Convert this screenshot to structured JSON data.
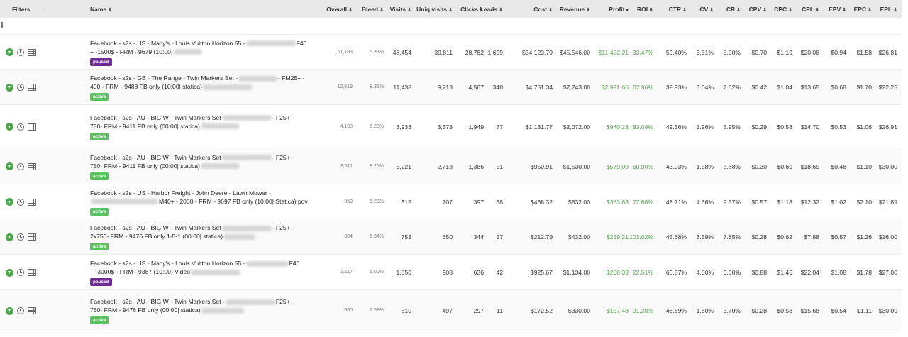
{
  "header": {
    "filters": "Filters",
    "columns": [
      {
        "key": "name",
        "label": "Name",
        "sort": "⬍"
      },
      {
        "key": "overall",
        "label": "Overall",
        "sort": "⬍"
      },
      {
        "key": "bleed",
        "label": "Bleed",
        "sort": "⬍"
      },
      {
        "key": "visits",
        "label": "Visits",
        "sort": "⬍"
      },
      {
        "key": "uniq",
        "label": "Uniq visits",
        "sort": "⬍"
      },
      {
        "key": "clicks",
        "label": "Clicks",
        "sort": "⬍"
      },
      {
        "key": "leads",
        "label": "Leads",
        "sort": "⬍"
      },
      {
        "key": "cost",
        "label": "Cost",
        "sort": "⬍"
      },
      {
        "key": "revenue",
        "label": "Revenue",
        "sort": "⬍"
      },
      {
        "key": "profit",
        "label": "Profit",
        "sort": "▾"
      },
      {
        "key": "roi",
        "label": "ROI",
        "sort": "⬍"
      },
      {
        "key": "ctr",
        "label": "CTR",
        "sort": "⬍"
      },
      {
        "key": "cv",
        "label": "CV",
        "sort": "⬍"
      },
      {
        "key": "cr",
        "label": "CR",
        "sort": "⬍"
      },
      {
        "key": "cpv",
        "label": "CPV",
        "sort": "⬍"
      },
      {
        "key": "cpc",
        "label": "CPC",
        "sort": "⬍"
      },
      {
        "key": "cpl",
        "label": "CPL",
        "sort": "⬍"
      },
      {
        "key": "epv",
        "label": "EPV",
        "sort": "⬍"
      },
      {
        "key": "epc",
        "label": "EPC",
        "sort": "⬍"
      },
      {
        "key": "epl",
        "label": "EPL",
        "sort": "⬍"
      }
    ]
  },
  "colors": {
    "paused": "#6f2c91",
    "active": "#5cbf60",
    "profit": "#55a54f",
    "play_icon": "#4ca64c"
  },
  "icons": [
    "play-circle-icon",
    "clock-icon",
    "table-icon"
  ],
  "rows": [
    {
      "name_line1": "Facebook - s2s - US - Macy's - Louis Vuitton Horizon 55 -",
      "name_line1_tail": "F40",
      "name_line2": "+ -1500$ - FRM - 9679 (10:00)",
      "name_line2_tail": "",
      "status": "paused",
      "overall": "51,183",
      "bleed": "5.33%",
      "visits": "48,454",
      "uniq": "39,811",
      "clicks": "28,782",
      "leads": "1,699",
      "cost": "$34,123.79",
      "revenue": "$45,546.00",
      "profit": "$11,422.21",
      "roi": "33.47%",
      "ctr": "59.40%",
      "cv": "3.51%",
      "cr": "5.90%",
      "cpv": "$0.70",
      "cpc": "$1.19",
      "cpl": "$20.08",
      "epv": "$0.94",
      "epc": "$1.58",
      "epl": "$26.81"
    },
    {
      "name_line1": "Facebook - s2s - GB - The Range - Twin Markers Set -",
      "name_line1_tail": "- FM25+ -",
      "name_line2": "400 - FRM - 9488 FB only (10:00| statica)",
      "name_line2_tail": "",
      "status": "active",
      "overall": "12,619",
      "bleed": "9.36%",
      "visits": "11,438",
      "uniq": "9,213",
      "clicks": "4,567",
      "leads": "348",
      "cost": "$4,751.34",
      "revenue": "$7,743.00",
      "profit": "$2,991.66",
      "roi": "62.96%",
      "ctr": "39.93%",
      "cv": "3.04%",
      "cr": "7.62%",
      "cpv": "$0.42",
      "cpc": "$1.04",
      "cpl": "$13.65",
      "epv": "$0.68",
      "epc": "$1.70",
      "epl": "$22.25"
    },
    {
      "name_line1": "Facebook - s2s - AU - BIG W - Twin Markers Set",
      "name_line1_tail": "- F25+ -",
      "name_line2": "750- FRM - 9411 FB only (00:00| statica)",
      "name_line2_tail": "",
      "status": "active",
      "overall": "4,193",
      "bleed": "6.20%",
      "visits": "3,933",
      "uniq": "3,373",
      "clicks": "1,949",
      "leads": "77",
      "cost": "$1,131.77",
      "revenue": "$2,072.00",
      "profit": "$940.23",
      "roi": "83.08%",
      "ctr": "49.56%",
      "cv": "1.96%",
      "cr": "3.95%",
      "cpv": "$0.29",
      "cpc": "$0.58",
      "cpl": "$14.70",
      "epv": "$0.53",
      "epc": "$1.06",
      "epl": "$26.91"
    },
    {
      "name_line1": "Facebook - s2s - AU - BIG W - Twin Markers Set",
      "name_line1_tail": "- F25+ -",
      "name_line2": "750- FRM - 9411 FB only (00:00| statica)",
      "name_line2_tail": "",
      "status": "active",
      "overall": "3,511",
      "bleed": "8.26%",
      "visits": "3,221",
      "uniq": "2,713",
      "clicks": "1,386",
      "leads": "51",
      "cost": "$950.91",
      "revenue": "$1,530.00",
      "profit": "$579.09",
      "roi": "60.90%",
      "ctr": "43.03%",
      "cv": "1.58%",
      "cr": "3.68%",
      "cpv": "$0.30",
      "cpc": "$0.69",
      "cpl": "$18.65",
      "epv": "$0.48",
      "epc": "$1.10",
      "epl": "$30.00"
    },
    {
      "name_line1": "Facebook - s2s - US - Harbor Freight - John Deere - Lawn Mower -",
      "name_line1_tail": "",
      "name_line2": "M40+ - 2000 - FRM - 9697 FB only (10:00| Statica) pov",
      "name_line2_tail": "",
      "status": "active",
      "overall": "860",
      "bleed": "5.23%",
      "visits": "815",
      "uniq": "707",
      "clicks": "397",
      "leads": "38",
      "cost": "$468.32",
      "revenue": "$832.00",
      "profit": "$363.68",
      "roi": "77.66%",
      "ctr": "48.71%",
      "cv": "4.66%",
      "cr": "9.57%",
      "cpv": "$0.57",
      "cpc": "$1.18",
      "cpl": "$12.32",
      "epv": "$1.02",
      "epc": "$2.10",
      "epl": "$21.89"
    },
    {
      "name_line1": "Facebook - s2s - AU - BIG W - Twin Markers Set",
      "name_line1_tail": "- F25+ -",
      "name_line2": "2x750- FRM - 9476 FB only 1-5-1 (00:00| statica)",
      "name_line2_tail": "",
      "status": "active",
      "overall": "804",
      "bleed": "6.34%",
      "visits": "753",
      "uniq": "650",
      "clicks": "344",
      "leads": "27",
      "cost": "$212.79",
      "revenue": "$432.00",
      "profit": "$219.21",
      "roi": "103.02%",
      "ctr": "45.68%",
      "cv": "3.59%",
      "cr": "7.85%",
      "cpv": "$0.28",
      "cpc": "$0.62",
      "cpl": "$7.88",
      "epv": "$0.57",
      "epc": "$1.26",
      "epl": "$16.00"
    },
    {
      "name_line1": "Facebook - s2s - US - Macy's - Louis Vuitton Horizon 55 -",
      "name_line1_tail": "F40",
      "name_line2": "+ -3000$ - FRM - 9387 (10:00) Video",
      "name_line2_tail": "",
      "status": "paused",
      "overall": "1,117",
      "bleed": "6.00%",
      "visits": "1,050",
      "uniq": "908",
      "clicks": "636",
      "leads": "42",
      "cost": "$925.67",
      "revenue": "$1,134.00",
      "profit": "$208.33",
      "roi": "22.51%",
      "ctr": "60.57%",
      "cv": "4.00%",
      "cr": "6.60%",
      "cpv": "$0.88",
      "cpc": "$1.46",
      "cpl": "$22.04",
      "epv": "$1.08",
      "epc": "$1.78",
      "epl": "$27.00"
    },
    {
      "name_line1": "Facebook - s2s - AU - BIG W - Twin Markers Set -",
      "name_line1_tail": "F25+ -",
      "name_line2": "750- FRM - 9476 FB only (00:00| statica)",
      "name_line2_tail": "",
      "status": "active",
      "overall": "660",
      "bleed": "7.58%",
      "visits": "610",
      "uniq": "497",
      "clicks": "297",
      "leads": "11",
      "cost": "$172.52",
      "revenue": "$330.00",
      "profit": "$157.48",
      "roi": "91.28%",
      "ctr": "48.69%",
      "cv": "1.80%",
      "cr": "3.70%",
      "cpv": "$0.28",
      "cpc": "$0.58",
      "cpl": "$15.68",
      "epv": "$0.54",
      "epc": "$1.11",
      "epl": "$30.00"
    }
  ]
}
